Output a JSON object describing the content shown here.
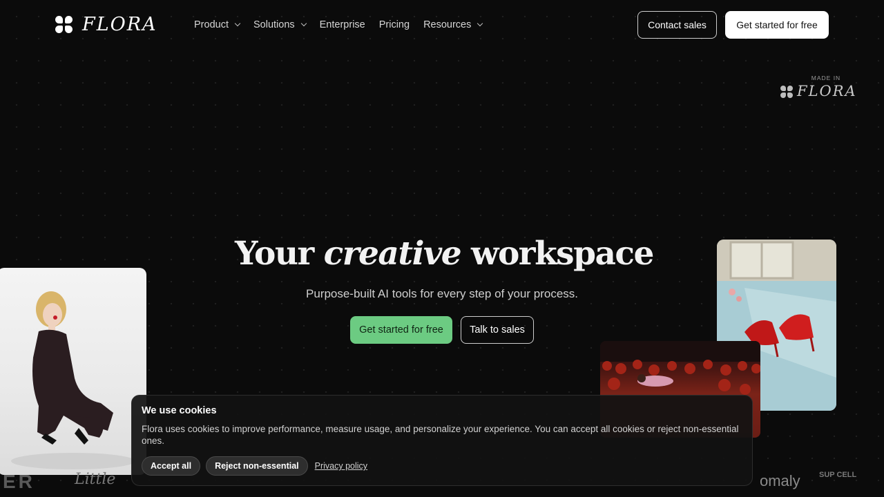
{
  "nav": {
    "logo_text": "FLORA",
    "menu": [
      {
        "label": "Product",
        "has_dropdown": true
      },
      {
        "label": "Solutions",
        "has_dropdown": true
      },
      {
        "label": "Enterprise",
        "has_dropdown": false
      },
      {
        "label": "Pricing",
        "has_dropdown": false
      },
      {
        "label": "Resources",
        "has_dropdown": true
      }
    ],
    "contact_label": "Contact sales",
    "start_label": "Get started for free"
  },
  "badge": {
    "label": "MADE IN",
    "logo_text": "FLORA"
  },
  "hero": {
    "title_before": "Your ",
    "title_emphasis": "creative",
    "title_after": " workspace",
    "subtitle": "Purpose-built AI tools for every step of your process.",
    "primary_label": "Get started for free",
    "secondary_label": "Talk to sales",
    "accent_color": "#6ccb82"
  },
  "logo_strip": [
    "ER",
    "Little",
    "omaly",
    "SUP CELL"
  ],
  "cookie": {
    "title": "We use cookies",
    "text": "Flora uses cookies to improve performance, measure usage, and personalize your experience. You can accept all cookies or reject non-essential ones.",
    "accept_label": "Accept all",
    "reject_label": "Reject non-essential",
    "privacy_label": "Privacy policy"
  }
}
